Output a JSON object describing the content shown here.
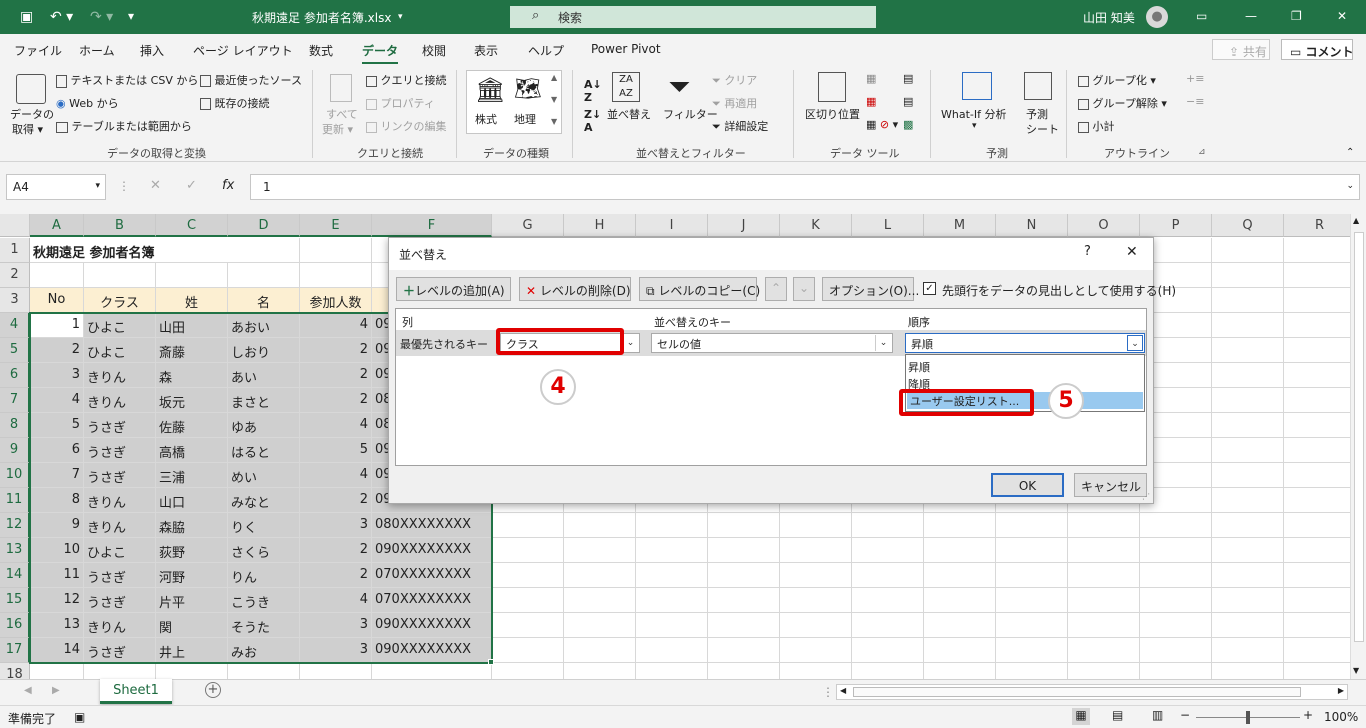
{
  "title": {
    "filename": "秋期遠足 参加者名簿.xlsx",
    "search": "検索",
    "user": "山田 知美"
  },
  "menu": [
    "ファイル",
    "ホーム",
    "挿入",
    "ページ レイアウト",
    "数式",
    "データ",
    "校閲",
    "表示",
    "ヘルプ",
    "Power Pivot"
  ],
  "share": "共有",
  "comment": "コメント",
  "ribbon": {
    "get_data": "データの",
    "get_data2": "取得",
    "from_csv": "テキストまたは CSV から",
    "from_web": "Web から",
    "from_table": "テーブルまたは範囲から",
    "recent": "最近使ったソース",
    "existing": "既存の接続",
    "refresh_all": "すべて",
    "refresh_all2": "更新",
    "queries": "クエリと接続",
    "properties": "プロパティ",
    "edit_links": "リンクの編集",
    "stock": "株式",
    "geo": "地理",
    "sort": "並べ替え",
    "filter": "フィルター",
    "clear": "クリア",
    "reapply": "再適用",
    "advanced": "詳細設定",
    "text_to_col": "区切り位置",
    "whatif": "What-If 分析",
    "forecast": "予測",
    "forecast2": "シート",
    "group": "グループ化",
    "ungroup": "グループ解除",
    "subtotal": "小計",
    "groups": [
      "データの取得と変換",
      "クエリと接続",
      "データの種類",
      "並べ替えとフィルター",
      "データ ツール",
      "予測",
      "アウトライン"
    ]
  },
  "formula": {
    "namebox": "A4",
    "value": "1"
  },
  "columns": [
    "A",
    "B",
    "C",
    "D",
    "E",
    "F",
    "G",
    "H",
    "I",
    "J",
    "K",
    "L",
    "M",
    "N",
    "O",
    "P",
    "Q",
    "R"
  ],
  "rows": [
    "1",
    "2",
    "3",
    "4",
    "5",
    "6",
    "7",
    "8",
    "9",
    "10",
    "11",
    "12",
    "13",
    "14",
    "15",
    "16",
    "17",
    "18"
  ],
  "sheet_title": "秋期遠足 参加者名簿",
  "headers": [
    "No",
    "クラス",
    "姓",
    "名",
    "参加人数",
    ""
  ],
  "data": [
    [
      "1",
      "ひよこ",
      "山田",
      "あおい",
      "4",
      "09"
    ],
    [
      "2",
      "ひよこ",
      "斎藤",
      "しおり",
      "2",
      "09"
    ],
    [
      "3",
      "きりん",
      "森",
      "あい",
      "2",
      "09"
    ],
    [
      "4",
      "きりん",
      "坂元",
      "まさと",
      "2",
      "08"
    ],
    [
      "5",
      "うさぎ",
      "佐藤",
      "ゆあ",
      "4",
      "08"
    ],
    [
      "6",
      "うさぎ",
      "高橋",
      "はると",
      "5",
      "09"
    ],
    [
      "7",
      "うさぎ",
      "三浦",
      "めい",
      "4",
      "09"
    ],
    [
      "8",
      "きりん",
      "山口",
      "みなと",
      "2",
      "09"
    ],
    [
      "9",
      "きりん",
      "森脇",
      "りく",
      "3",
      "080XXXXXXXX"
    ],
    [
      "10",
      "ひよこ",
      "荻野",
      "さくら",
      "2",
      "090XXXXXXXX"
    ],
    [
      "11",
      "うさぎ",
      "河野",
      "りん",
      "2",
      "070XXXXXXXX"
    ],
    [
      "12",
      "うさぎ",
      "片平",
      "こうき",
      "4",
      "070XXXXXXXX"
    ],
    [
      "13",
      "きりん",
      "関",
      "そうた",
      "3",
      "090XXXXXXXX"
    ],
    [
      "14",
      "うさぎ",
      "井上",
      "みお",
      "3",
      "090XXXXXXXX"
    ]
  ],
  "sheet_tab": "Sheet1",
  "status": {
    "ready": "準備完了",
    "zoom": "100%"
  },
  "dialog": {
    "title": "並べ替え",
    "help": "?",
    "close": "✕",
    "add_level": "レベルの追加(A)",
    "del_level": "レベルの削除(D)",
    "copy_level": "レベルのコピー(C)",
    "options": "オプション(O)...",
    "has_header": "先頭行をデータの見出しとして使用する(H)",
    "col_head": "列",
    "key_head": "並べ替えのキー",
    "order_head": "順序",
    "row_label": "最優先されるキー",
    "column_value": "クラス",
    "key_value": "セルの値",
    "order_value": "昇順",
    "order_options": [
      "昇順",
      "降順",
      "ユーザー設定リスト..."
    ],
    "ok": "OK",
    "cancel": "キャンセル",
    "callout4": "4",
    "callout5": "5"
  }
}
